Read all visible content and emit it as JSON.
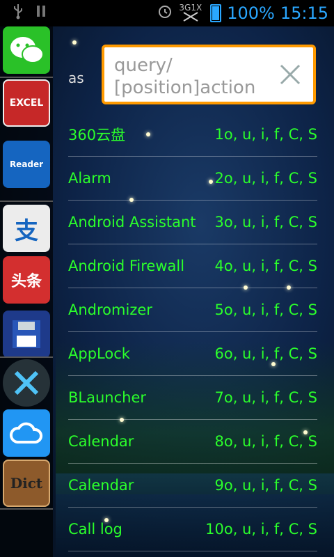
{
  "status": {
    "net_label": "3G1X",
    "battery_percent": "100%",
    "time": "15:15"
  },
  "dock": {
    "items": [
      {
        "name": "wechat"
      },
      {
        "name": "excel-sha"
      },
      {
        "name": "zreader",
        "label": "Reader"
      },
      {
        "name": "alipay"
      },
      {
        "name": "toutiao",
        "label": "头条"
      },
      {
        "name": "save-disk"
      },
      {
        "name": "x-app"
      },
      {
        "name": "cloud"
      },
      {
        "name": "dict",
        "label": "Dict"
      }
    ]
  },
  "search": {
    "filter_label": "as",
    "placeholder": "query/\n[position]action"
  },
  "list": [
    {
      "name": "360云盘",
      "shortcut": "1o, u, i, f, C, S"
    },
    {
      "name": "Alarm",
      "shortcut": "2o, u, i, f, C, S"
    },
    {
      "name": "Android Assistant",
      "shortcut": "3o, u, i, f, C, S"
    },
    {
      "name": "Android Firewall",
      "shortcut": "4o, u, i, f, C, S"
    },
    {
      "name": "Andromizer",
      "shortcut": "5o, u, i, f, C, S"
    },
    {
      "name": "AppLock",
      "shortcut": "6o, u, i, f, C, S"
    },
    {
      "name": "BLauncher",
      "shortcut": "7o, u, i, f, C, S"
    },
    {
      "name": "Calendar",
      "shortcut": "8o, u, i, f, C, S"
    },
    {
      "name": "Calendar",
      "shortcut": "9o, u, i, f, C, S"
    },
    {
      "name": "Call log",
      "shortcut": "10o, u, i, f, C, S"
    }
  ],
  "colors": {
    "accent": "#ff9a00",
    "text_green": "#2bff2b",
    "status_blue": "#2aa7ff"
  }
}
